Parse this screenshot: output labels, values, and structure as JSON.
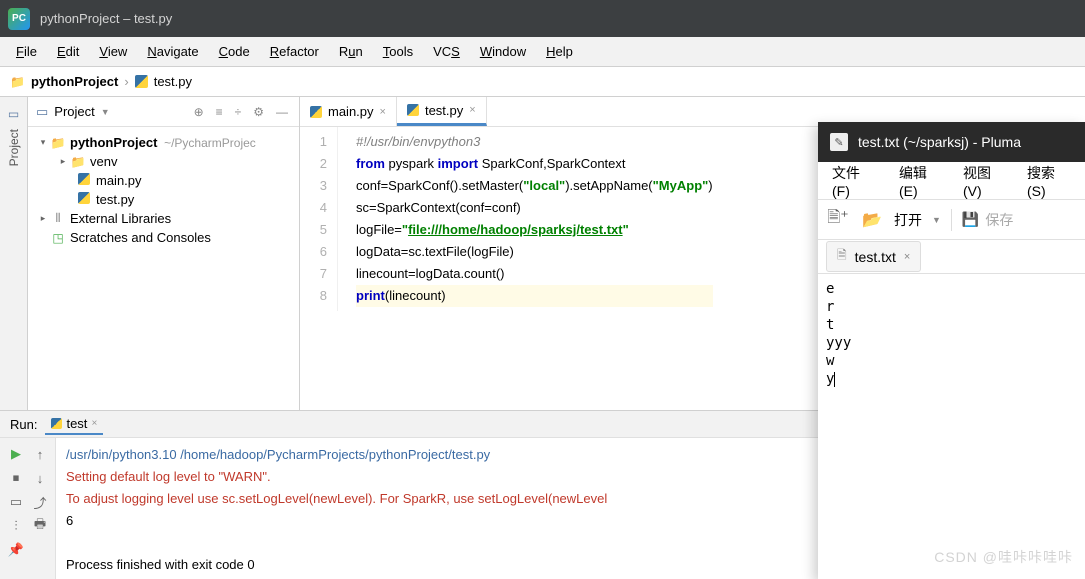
{
  "ide": {
    "titlebar": {
      "app_icon": "PC",
      "title": "pythonProject – test.py"
    },
    "menubar": [
      {
        "label": "File",
        "u": "F"
      },
      {
        "label": "Edit",
        "u": "E"
      },
      {
        "label": "View",
        "u": "V"
      },
      {
        "label": "Navigate",
        "u": "N"
      },
      {
        "label": "Code",
        "u": "C"
      },
      {
        "label": "Refactor",
        "u": "R"
      },
      {
        "label": "Run",
        "u": "u"
      },
      {
        "label": "Tools",
        "u": "T"
      },
      {
        "label": "VCS",
        "u": "S"
      },
      {
        "label": "Window",
        "u": "W"
      },
      {
        "label": "Help",
        "u": "H"
      }
    ],
    "breadcrumbs": {
      "root": "pythonProject",
      "file": "test.py"
    },
    "sidebar_label": "Project",
    "project_panel": {
      "title": "Project",
      "tree": {
        "root": {
          "name": "pythonProject",
          "hint": "~/PycharmProjec"
        },
        "venv": "venv",
        "files": [
          "main.py",
          "test.py"
        ],
        "ext_libs": "External Libraries",
        "scratches": "Scratches and Consoles"
      }
    },
    "editor": {
      "tabs": [
        {
          "name": "main.py",
          "active": false
        },
        {
          "name": "test.py",
          "active": true
        }
      ],
      "code_lines": [
        {
          "n": 1,
          "html": "<span class='c-comment'>#!/usr/bin/envpython3</span>"
        },
        {
          "n": 2,
          "html": "<span class='c-kw'>from</span> pyspark <span class='c-kw'>import</span> SparkConf,SparkContext"
        },
        {
          "n": 3,
          "html": "conf=SparkConf().setMaster(<span class='c-str'>\"local\"</span>).setAppName(<span class='c-str'>\"MyApp\"</span>)"
        },
        {
          "n": 4,
          "html": "sc=SparkContext(<span class='c-fn'>conf</span>=conf)"
        },
        {
          "n": 5,
          "html": "logFile=<span class='c-str'>\"<span class='u'>file:///home/hadoop/sparksj/test.txt</span>\"</span>"
        },
        {
          "n": 6,
          "html": "logData=sc.textFile(logFile)"
        },
        {
          "n": 7,
          "html": "linecount=logData.count()"
        },
        {
          "n": 8,
          "html": "<span class='c-kw'>print</span>(linecount)",
          "cur": true
        }
      ]
    },
    "run": {
      "label": "Run:",
      "config": "test",
      "console": [
        {
          "cls": "c-path",
          "text": "/usr/bin/python3.10 /home/hadoop/PycharmProjects/pythonProject/test.py"
        },
        {
          "cls": "c-red",
          "text": "Setting default log level to \"WARN\"."
        },
        {
          "cls": "c-red",
          "text": "To adjust logging level use sc.setLogLevel(newLevel). For SparkR, use setLogLevel(newLevel"
        },
        {
          "cls": "",
          "text": "6"
        },
        {
          "cls": "",
          "text": ""
        },
        {
          "cls": "",
          "text": "Process finished with exit code 0"
        }
      ]
    }
  },
  "pluma": {
    "title": "test.txt (~/sparksj) - Pluma",
    "menubar": [
      "文件 (F)",
      "编辑(E)",
      "视图(V)",
      "搜索(S)"
    ],
    "toolbar": {
      "open": "打开",
      "save": "保存"
    },
    "tab": "test.txt",
    "content": [
      "e",
      "r",
      "t",
      "yyy",
      "w",
      "y"
    ]
  },
  "watermark": "CSDN @哇咔咔哇咔"
}
